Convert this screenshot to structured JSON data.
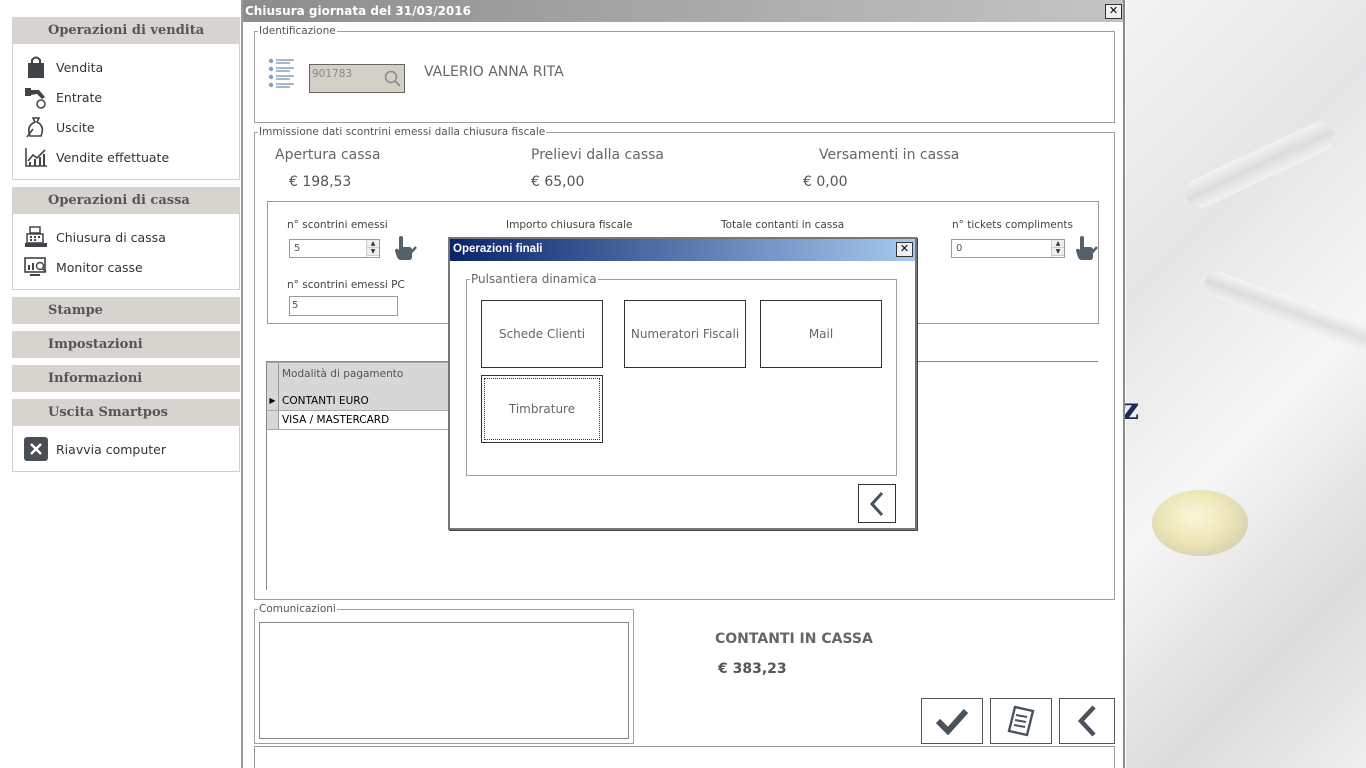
{
  "sidebar": {
    "sections": [
      {
        "title": "Operazioni di vendita"
      },
      {
        "title": "Operazioni di cassa"
      },
      {
        "title": "Stampe"
      },
      {
        "title": "Impostazioni"
      },
      {
        "title": "Informazioni"
      },
      {
        "title": "Uscita Smartpos"
      }
    ],
    "vendita_items": [
      {
        "label": "Vendita",
        "icon": "shopping-bag-icon"
      },
      {
        "label": "Entrate",
        "icon": "hand-coin-icon"
      },
      {
        "label": "Uscite",
        "icon": "money-bag-icon"
      },
      {
        "label": "Vendite effettuate",
        "icon": "bar-chart-icon"
      }
    ],
    "cassa_items": [
      {
        "label": "Chiusura di cassa",
        "icon": "cash-register-icon"
      },
      {
        "label": "Monitor casse",
        "icon": "monitor-icon"
      }
    ],
    "uscita_items": [
      {
        "label": "Riavvia computer",
        "icon": "close-square-icon"
      }
    ]
  },
  "window": {
    "title": "Chiusura giornata del 31/03/2016",
    "close": "✕"
  },
  "identificazione": {
    "legend": "Identificazione",
    "code": "901783",
    "name": "VALERIO ANNA RITA"
  },
  "immissione": {
    "legend": "Immissione dati scontrini emessi dalla chiusura fiscale",
    "apertura_label": "Apertura cassa",
    "apertura_value": "€ 198,53",
    "prelievi_label": "Prelievi dalla cassa",
    "prelievi_value": "€ 65,00",
    "versamenti_label": "Versamenti in cassa",
    "versamenti_value": "€ 0,00",
    "scontrini_label": "n° scontrini emessi",
    "scontrini_value": "5",
    "importo_label": "Importo chiusura fiscale",
    "totale_label": "Totale contanti in cassa",
    "tickets_label": "n° tickets compliments",
    "tickets_value": "0",
    "scontrini_pc_label": "n° scontrini emessi PC",
    "scontrini_pc_value": "5"
  },
  "grid": {
    "header": "Modalità di pagamento",
    "rows": [
      "CONTANTI EURO",
      "VISA / MASTERCARD"
    ]
  },
  "comunicazioni": {
    "legend": "Comunicazioni"
  },
  "summary": {
    "label": "CONTANTI IN CASSA",
    "value": "€ 383,23"
  },
  "dialog": {
    "title": "Operazioni finali",
    "close": "✕",
    "legend": "Pulsantiera dinamica",
    "buttons": [
      "Schede Clienti",
      "Numeratori Fiscali",
      "Mail",
      "Timbrature"
    ]
  }
}
